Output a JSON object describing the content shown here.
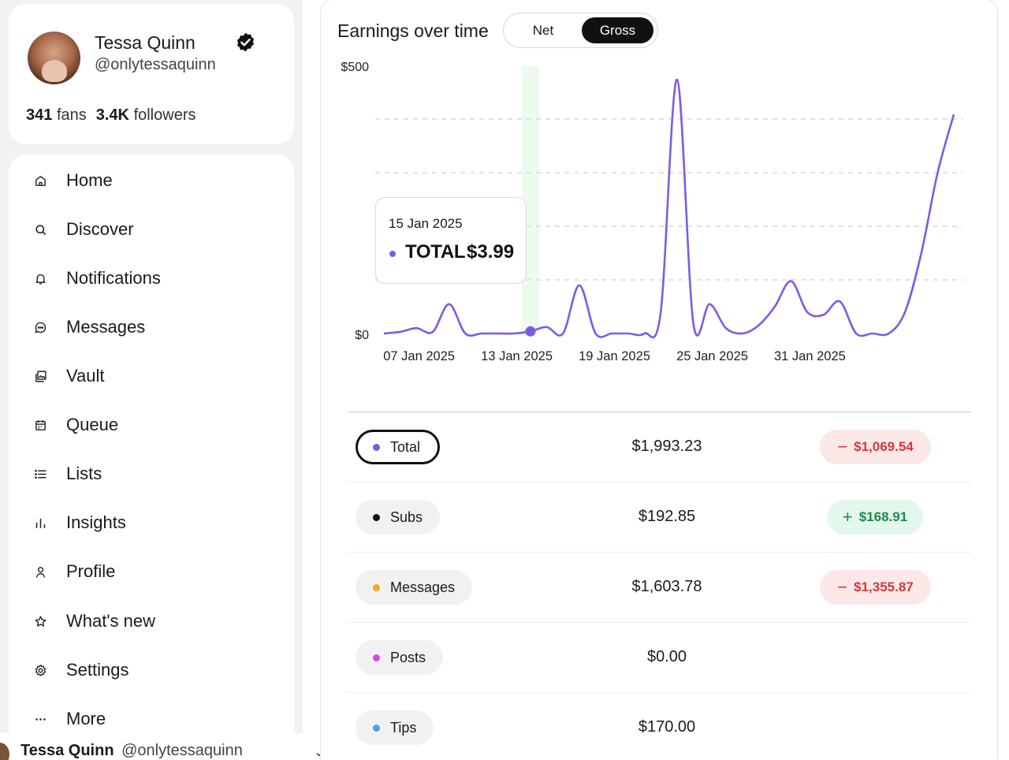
{
  "profile": {
    "name": "Tessa Quinn",
    "handle": "@onlytessaquinn",
    "fans_count": "341",
    "fans_label": "fans",
    "followers_count": "3.4K",
    "followers_label": "followers"
  },
  "nav": {
    "items": [
      {
        "label": "Home",
        "icon": "home-icon"
      },
      {
        "label": "Discover",
        "icon": "search-icon"
      },
      {
        "label": "Notifications",
        "icon": "bell-icon"
      },
      {
        "label": "Messages",
        "icon": "chat-icon"
      },
      {
        "label": "Vault",
        "icon": "vault-icon"
      },
      {
        "label": "Queue",
        "icon": "calendar-icon"
      },
      {
        "label": "Lists",
        "icon": "list-icon"
      },
      {
        "label": "Insights",
        "icon": "bar-chart-icon"
      },
      {
        "label": "Profile",
        "icon": "user-icon"
      },
      {
        "label": "What's new",
        "icon": "star-icon"
      },
      {
        "label": "Settings",
        "icon": "gear-icon"
      },
      {
        "label": "More",
        "icon": "more-icon"
      }
    ]
  },
  "footer": {
    "name": "Tessa Quinn",
    "handle": "@onlytessaquinn"
  },
  "earnings": {
    "title": "Earnings over time",
    "toggle": {
      "net_label": "Net",
      "gross_label": "Gross",
      "selected": "Gross"
    },
    "tooltip": {
      "date": "15 Jan 2025",
      "label": "TOTAL",
      "value": "$3.99"
    },
    "rows": [
      {
        "label": "Total",
        "dot_color": "#7b5ce8",
        "amount": "$1,993.23",
        "change": "$1,069.54",
        "direction": "down",
        "active": true
      },
      {
        "label": "Subs",
        "dot_color": "#111111",
        "amount": "$192.85",
        "change": "$168.91",
        "direction": "up",
        "active": false
      },
      {
        "label": "Messages",
        "dot_color": "#f5a623",
        "amount": "$1,603.78",
        "change": "$1,355.87",
        "direction": "down",
        "active": false
      },
      {
        "label": "Posts",
        "dot_color": "#d946ef",
        "amount": "$0.00",
        "change": "",
        "direction": "none",
        "active": false
      },
      {
        "label": "Tips",
        "dot_color": "#3ba7f2",
        "amount": "$170.00",
        "change": "",
        "direction": "none",
        "active": false
      }
    ]
  },
  "chart_data": {
    "type": "line",
    "series": [
      {
        "values": [
          0,
          3,
          10,
          3,
          55,
          0,
          0,
          0,
          0,
          3.99,
          12,
          0,
          90,
          0,
          0,
          0,
          0,
          40,
          475,
          20,
          55,
          10,
          0,
          15,
          50,
          98,
          40,
          35,
          60,
          0,
          0,
          0,
          40,
          150,
          300,
          410
        ]
      }
    ],
    "x_start": "2025-01-06",
    "x_end": "2025-02-10",
    "tick_labels": [
      "07 Jan 2025",
      "13 Jan 2025",
      "19 Jan 2025",
      "25 Jan 2025",
      "31 Jan 2025"
    ],
    "y_ticks": [
      "$0",
      "$500"
    ],
    "ylim": [
      0,
      500
    ],
    "line_color": "#7b5ce8",
    "highlight_date": "15 Jan 2025",
    "grid": "dashed"
  }
}
